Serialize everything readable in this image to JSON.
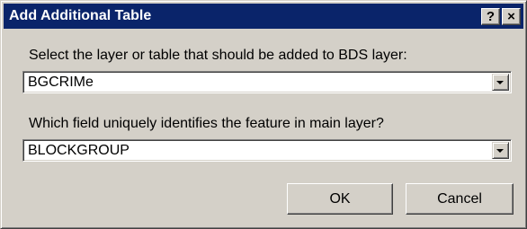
{
  "window": {
    "title": "Add Additional Table",
    "help_label": "?",
    "close_label": "×"
  },
  "layer_select": {
    "label": "Select the layer or table that should be added to BDS layer:",
    "value": "BGCRIMe",
    "icon": "dropdown-arrow-icon"
  },
  "field_select": {
    "label": "Which field uniquely identifies the feature in main layer?",
    "value": "BLOCKGROUP",
    "icon": "dropdown-arrow-icon"
  },
  "buttons": {
    "ok_label": "OK",
    "cancel_label": "Cancel"
  },
  "colors": {
    "titlebar": "#0a246a",
    "dialog_face": "#d4d0c8",
    "field_background": "#ffffff"
  }
}
